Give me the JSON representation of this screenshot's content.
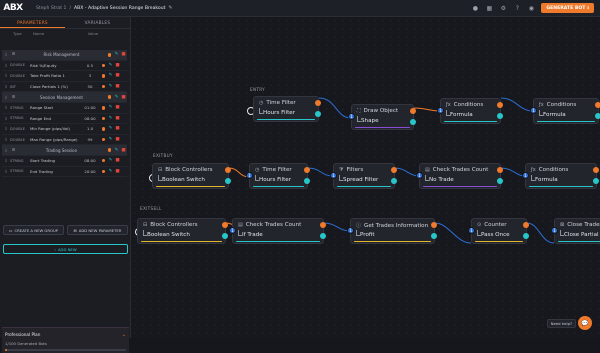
{
  "app": {
    "logo_text": "ABX",
    "breadcrumb": [
      "Steph Strat 1",
      "ABX - Adaptive Session Range Breakout"
    ],
    "breadcrumb_sep": "/",
    "generate_label": "GENERATE BOT",
    "accent": "#f07a2b",
    "teal": "#27c7c9",
    "blue": "#2c6fd6"
  },
  "sidebar": {
    "tabs": [
      "PARAMETERS",
      "VARIABLES"
    ],
    "active_tab": 0,
    "columns": [
      "Type",
      "Name",
      "Value"
    ],
    "rows": [
      {
        "kind": "section",
        "title": "Risk Management"
      },
      {
        "kind": "row",
        "type": "DOUBLE",
        "name": "Risk %/Equity",
        "value": "0.5"
      },
      {
        "kind": "row",
        "type": "DOUBLE",
        "name": "Take Profit Ratio 1",
        "value": "3"
      },
      {
        "kind": "row",
        "type": "INT",
        "name": "Close Partials 1 (%)",
        "value": "50"
      },
      {
        "kind": "section",
        "title": "Session Management"
      },
      {
        "kind": "row",
        "type": "STRING",
        "name": "Range Start",
        "value": "01:00"
      },
      {
        "kind": "row",
        "type": "STRING",
        "name": "Range End",
        "value": "08:00"
      },
      {
        "kind": "row",
        "type": "DOUBLE",
        "name": "Min Range (pips/Vol)",
        "value": "1.0"
      },
      {
        "kind": "row",
        "type": "DOUBLE",
        "name": "Max Range (pips/Range)",
        "value": "99"
      },
      {
        "kind": "section",
        "title": "Trading Session"
      },
      {
        "kind": "row",
        "type": "STRING",
        "name": "Start Trading",
        "value": "08:00"
      },
      {
        "kind": "row",
        "type": "STRING",
        "name": "End Trading",
        "value": "20:00"
      }
    ],
    "buttons": [
      "CREATE A NEW GROUP",
      "ADD NEW PARAMETER"
    ],
    "add_label": "ADD NEW",
    "plan": {
      "title": "Professional Plan",
      "usage": "1/100 Generated Bots",
      "progress": 0.01
    }
  },
  "canvas": {
    "groups": [
      "ENTRY",
      "EXITBUY",
      "EXITSELL"
    ],
    "chat_label": "Need help?",
    "nodes": [
      {
        "id": "n1",
        "icon": "clock-icon",
        "title": "Time Filter",
        "value": "Hours Filter",
        "underline": "#27c7c9",
        "port": ""
      },
      {
        "id": "n2",
        "icon": "shape-icon",
        "title": "Draw Object",
        "value": "Shape",
        "underline": "#8a4dd6",
        "port": "1"
      },
      {
        "id": "n3",
        "icon": "fx-icon",
        "title": "Conditions",
        "value": "Formula",
        "underline": "#27c7c9",
        "port": "1"
      },
      {
        "id": "n4",
        "icon": "fx-icon",
        "title": "Conditions",
        "value": "Formula",
        "underline": "#27c7c9",
        "port": "1"
      },
      {
        "id": "n5",
        "icon": "block-icon",
        "title": "Block Controllers",
        "value": "Boolean Switch",
        "underline": "#e2b52c",
        "port": ""
      },
      {
        "id": "n6",
        "icon": "clock-icon",
        "title": "Time Filter",
        "value": "Hours Filter",
        "underline": "#27c7c9",
        "port": "1"
      },
      {
        "id": "n7",
        "icon": "filter-icon",
        "title": "Filters",
        "value": "Spread Filter",
        "underline": "#27c7c9",
        "port": "1"
      },
      {
        "id": "n8",
        "icon": "chart-icon",
        "title": "Check Trades Count",
        "value": "No Trade",
        "underline": "#8a4dd6",
        "port": "1"
      },
      {
        "id": "n9",
        "icon": "fx-icon",
        "title": "Conditions",
        "value": "Formula",
        "underline": "#27c7c9",
        "port": "1"
      },
      {
        "id": "n10",
        "icon": "block-icon",
        "title": "Block Controllers",
        "value": "Boolean Switch",
        "underline": "#e2b52c",
        "port": ""
      },
      {
        "id": "n11",
        "icon": "chart-icon",
        "title": "Check Trades Count",
        "value": "If Trade",
        "underline": "#27c7c9",
        "port": "1"
      },
      {
        "id": "n12",
        "icon": "info-icon",
        "title": "Get Trades Information",
        "value": "Profit",
        "underline": "#e2b52c",
        "port": "1"
      },
      {
        "id": "n13",
        "icon": "counter-icon",
        "title": "Counter",
        "value": "Pass Once",
        "underline": "#e2b52c",
        "port": "1"
      },
      {
        "id": "n14",
        "icon": "close-trades-icon",
        "title": "Close Trades",
        "value": "Close Partial",
        "underline": "#27c7c9",
        "port": "1"
      }
    ]
  }
}
